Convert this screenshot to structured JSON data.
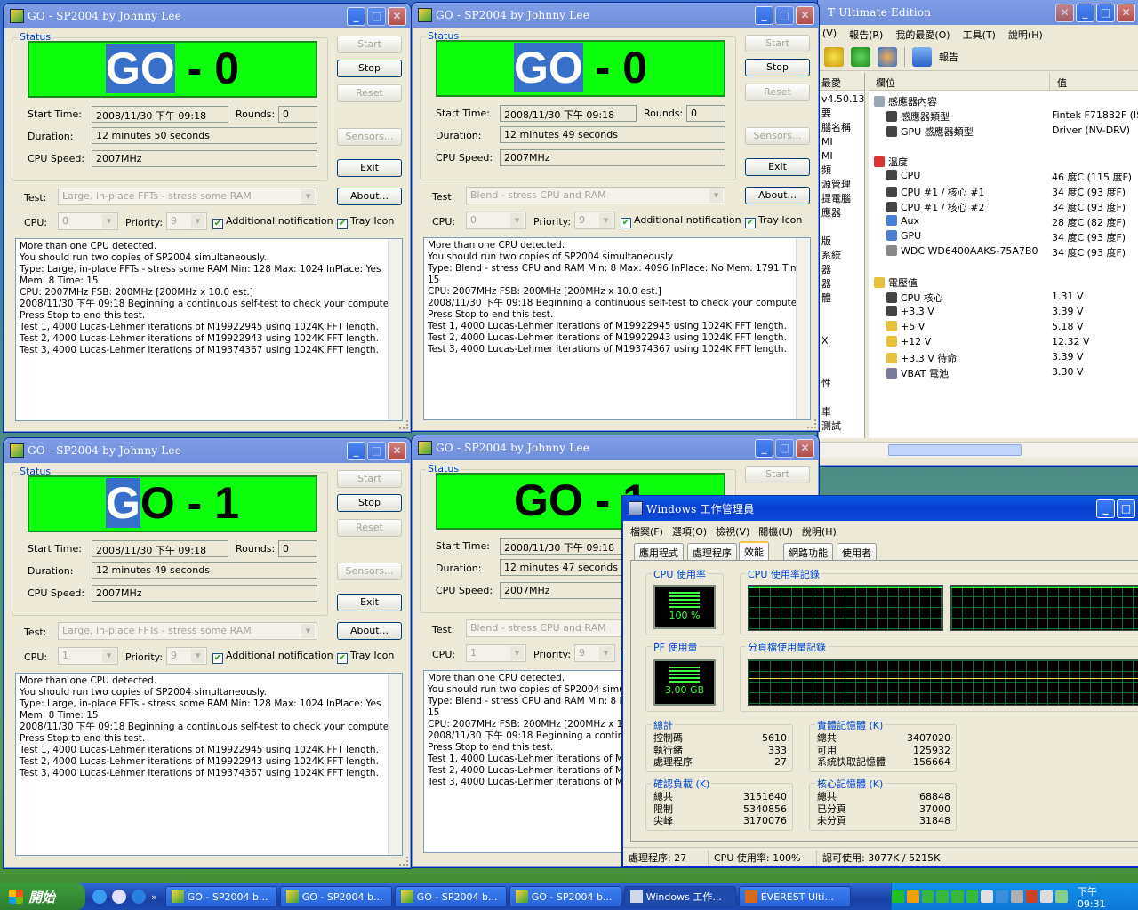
{
  "sp_windows": [
    {
      "title": "GO - SP2004 by Johnny Lee",
      "status_label": "Status",
      "go_pre": "",
      "go_hl": "GO",
      "go_post": " - 0",
      "go_mode": "b",
      "start_time_label": "Start Time:",
      "start_time": "2008/11/30 下午 09:18",
      "rounds_label": "Rounds:",
      "rounds": "0",
      "duration_label": "Duration:",
      "duration": "12 minutes 50 seconds",
      "cpu_speed_label": "CPU Speed:",
      "cpu_speed": "2007MHz",
      "btn_start": "Start",
      "btn_stop": "Stop",
      "btn_reset": "Reset",
      "btn_sensors": "Sensors...",
      "btn_exit": "Exit",
      "btn_about": "About...",
      "test_label": "Test:",
      "test_value": "Large, in-place FFTs - stress some RAM",
      "cpu_label": "CPU:",
      "cpu_value": "0",
      "priority_label": "Priority:",
      "priority_value": "9",
      "notif_label": "Additional notification",
      "tray_label": "Tray Icon",
      "log": "More than one CPU detected.\nYou should run two copies of SP2004 simultaneously.\nType: Large, in-place FFTs - stress some RAM Min: 128 Max: 1024 InPlace: Yes\nMem: 8 Time: 15\nCPU: 2007MHz FSB: 200MHz [200MHz x 10.0 est.]\n2008/11/30 下午 09:18 Beginning a continuous self-test to check your computer.\nPress Stop to end this test.\nTest 1, 4000 Lucas-Lehmer iterations of M19922945 using 1024K FFT length.\nTest 2, 4000 Lucas-Lehmer iterations of M19922943 using 1024K FFT length.\nTest 3, 4000 Lucas-Lehmer iterations of M19374367 using 1024K FFT length."
    },
    {
      "title": "GO - SP2004 by Johnny Lee",
      "status_label": "Status",
      "go_pre": "",
      "go_hl": "GO",
      "go_post": " - 0",
      "go_mode": "all",
      "start_time_label": "Start Time:",
      "start_time": "2008/11/30 下午 09:18",
      "rounds_label": "Rounds:",
      "rounds": "0",
      "duration_label": "Duration:",
      "duration": "12 minutes 49 seconds",
      "cpu_speed_label": "CPU Speed:",
      "cpu_speed": "2007MHz",
      "btn_start": "Start",
      "btn_stop": "Stop",
      "btn_reset": "Reset",
      "btn_sensors": "Sensors...",
      "btn_exit": "Exit",
      "btn_about": "About...",
      "test_label": "Test:",
      "test_value": "Blend - stress CPU and RAM",
      "cpu_label": "CPU:",
      "cpu_value": "0",
      "priority_label": "Priority:",
      "priority_value": "9",
      "notif_label": "Additional notification",
      "tray_label": "Tray Icon",
      "log": "More than one CPU detected.\nYou should run two copies of SP2004 simultaneously.\nType: Blend - stress CPU and RAM Min: 8 Max: 4096 InPlace: No Mem: 1791 Time:\n15\nCPU: 2007MHz FSB: 200MHz [200MHz x 10.0 est.]\n2008/11/30 下午 09:18 Beginning a continuous self-test to check your computer.\nPress Stop to end this test.\nTest 1, 4000 Lucas-Lehmer iterations of M19922945 using 1024K FFT length.\nTest 2, 4000 Lucas-Lehmer iterations of M19922943 using 1024K FFT length.\nTest 3, 4000 Lucas-Lehmer iterations of M19374367 using 1024K FFT length."
    },
    {
      "title": "GO - SP2004 by Johnny Lee",
      "status_label": "Status",
      "go_pre": "",
      "go_hl": "G",
      "go_post": "O - 1",
      "go_mode": "g",
      "start_time_label": "Start Time:",
      "start_time": "2008/11/30 下午 09:18",
      "rounds_label": "Rounds:",
      "rounds": "0",
      "duration_label": "Duration:",
      "duration": "12 minutes 49 seconds",
      "cpu_speed_label": "CPU Speed:",
      "cpu_speed": "2007MHz",
      "btn_start": "Start",
      "btn_stop": "Stop",
      "btn_reset": "Reset",
      "btn_sensors": "Sensors...",
      "btn_exit": "Exit",
      "btn_about": "About...",
      "test_label": "Test:",
      "test_value": "Large, in-place FFTs - stress some RAM",
      "cpu_label": "CPU:",
      "cpu_value": "1",
      "priority_label": "Priority:",
      "priority_value": "9",
      "notif_label": "Additional notification",
      "tray_label": "Tray Icon",
      "log": "More than one CPU detected.\nYou should run two copies of SP2004 simultaneously.\nType: Large, in-place FFTs - stress some RAM Min: 128 Max: 1024 InPlace: Yes\nMem: 8 Time: 15\n2008/11/30 下午 09:18 Beginning a continuous self-test to check your computer.\nPress Stop to end this test.\nTest 1, 4000 Lucas-Lehmer iterations of M19922945 using 1024K FFT length.\nTest 2, 4000 Lucas-Lehmer iterations of M19922943 using 1024K FFT length.\nTest 3, 4000 Lucas-Lehmer iterations of M19374367 using 1024K FFT length."
    },
    {
      "title": "GO - SP2004 by Johnny Lee",
      "status_label": "Status",
      "go_pre": "GO - 1",
      "go_hl": "",
      "go_post": "",
      "go_mode": "none",
      "start_time_label": "Start Time:",
      "start_time": "2008/11/30 下午 09:18",
      "rounds_label": "",
      "rounds": "",
      "duration_label": "Duration:",
      "duration": "12 minutes 47 seconds",
      "cpu_speed_label": "CPU Speed:",
      "cpu_speed": "2007MHz",
      "btn_start": "Start",
      "btn_stop": "",
      "btn_reset": "",
      "btn_sensors": "",
      "btn_exit": "",
      "btn_about": "",
      "test_label": "Test:",
      "test_value": "Blend - stress CPU and RAM",
      "cpu_label": "CPU:",
      "cpu_value": "1",
      "priority_label": "Priority:",
      "priority_value": "9",
      "notif_label": "",
      "tray_label": "",
      "log": "More than one CPU detected.\nYou should run two copies of SP2004 simultan\nType: Blend - stress CPU and RAM Min: 8 Max\n15\nCPU: 2007MHz FSB: 200MHz [200MHz x 10.0 es\n2008/11/30 下午 09:18 Beginning a continuou\nPress Stop to end this test.\nTest 1, 4000 Lucas-Lehmer iterations of M199\nTest 2, 4000 Lucas-Lehmer iterations of M199\nTest 3, 4000 Lucas-Lehmer iterations of M193"
    }
  ],
  "everest": {
    "title": "T Ultimate Edition",
    "menu": [
      "報告(R)",
      "我的最愛(O)",
      "工具(T)",
      "說明(H)"
    ],
    "menu_partial": "(V)",
    "report_btn": "報告",
    "left_header": "最愛",
    "left_items": [
      "v4.50.13",
      "要",
      "腦名稱",
      "MI",
      "MI",
      "頻",
      "源管理",
      "提電腦",
      "應器",
      "",
      "版",
      "系統",
      "器",
      "器",
      "體",
      "",
      "",
      "X",
      "",
      "",
      "性",
      "",
      "車",
      "測試"
    ],
    "col_field": "欄位",
    "col_value": "值",
    "rows": [
      {
        "f": "感應器內容",
        "v": "",
        "indent": 0,
        "kind": "group"
      },
      {
        "f": "感應器類型",
        "v": "Fintek F71882F (IS",
        "indent": 1,
        "kind": "chip"
      },
      {
        "f": "GPU 感應器類型",
        "v": "Driver (NV-DRV)",
        "indent": 1,
        "kind": "chip"
      },
      {
        "f": "",
        "v": "",
        "indent": 0,
        "kind": "gap"
      },
      {
        "f": "溫度",
        "v": "",
        "indent": 0,
        "kind": "therm"
      },
      {
        "f": "CPU",
        "v": "46 度C (115 度F)",
        "indent": 1,
        "kind": "chip"
      },
      {
        "f": "CPU #1 / 核心 #1",
        "v": "34 度C (93 度F)",
        "indent": 1,
        "kind": "chip"
      },
      {
        "f": "CPU #1 / 核心 #2",
        "v": "34 度C (93 度F)",
        "indent": 1,
        "kind": "chip"
      },
      {
        "f": "Aux",
        "v": "28 度C (82 度F)",
        "indent": 1,
        "kind": "pc"
      },
      {
        "f": "GPU",
        "v": "34 度C (93 度F)",
        "indent": 1,
        "kind": "pc"
      },
      {
        "f": "WDC WD6400AAKS-75A7B0",
        "v": "34 度C (93 度F)",
        "indent": 1,
        "kind": "disk"
      },
      {
        "f": "",
        "v": "",
        "indent": 0,
        "kind": "gap"
      },
      {
        "f": "電壓值",
        "v": "",
        "indent": 0,
        "kind": "warn"
      },
      {
        "f": "CPU 核心",
        "v": "1.31 V",
        "indent": 1,
        "kind": "chip"
      },
      {
        "f": "+3.3 V",
        "v": "3.39 V",
        "indent": 1,
        "kind": "chip"
      },
      {
        "f": "+5 V",
        "v": "5.18 V",
        "indent": 1,
        "kind": "warn"
      },
      {
        "f": "+12 V",
        "v": "12.32 V",
        "indent": 1,
        "kind": "warn"
      },
      {
        "f": "+3.3 V 待命",
        "v": "3.39 V",
        "indent": 1,
        "kind": "warn"
      },
      {
        "f": "VBAT 電池",
        "v": "3.30 V",
        "indent": 1,
        "kind": "bat"
      }
    ]
  },
  "taskmgr": {
    "title": "Windows 工作管理員",
    "menu": [
      "檔案(F)",
      "選項(O)",
      "檢視(V)",
      "關機(U)",
      "說明(H)"
    ],
    "tabs": [
      "應用程式",
      "處理程序",
      "效能",
      "網路功能",
      "使用者"
    ],
    "active_tab": 2,
    "cpu_usage_label": "CPU 使用率",
    "cpu_usage_value": "100 %",
    "cpu_history_label": "CPU 使用率記錄",
    "pf_label": "PF 使用量",
    "pf_value": "3.00 GB",
    "pf_history_label": "分頁檔使用量記錄",
    "totals": {
      "label": "總計",
      "rows": [
        [
          "控制碼",
          "5610"
        ],
        [
          "執行緒",
          "333"
        ],
        [
          "處理程序",
          "27"
        ]
      ]
    },
    "physical": {
      "label": "實體記憶體 (K)",
      "rows": [
        [
          "總共",
          "3407020"
        ],
        [
          "可用",
          "125932"
        ],
        [
          "系統快取記憶體",
          "156664"
        ]
      ]
    },
    "commit": {
      "label": "確認負載 (K)",
      "rows": [
        [
          "總共",
          "3151640"
        ],
        [
          "限制",
          "5340856"
        ],
        [
          "尖峰",
          "3170076"
        ]
      ]
    },
    "kernel": {
      "label": "核心記憶體 (K)",
      "rows": [
        [
          "總共",
          "68848"
        ],
        [
          "已分頁",
          "37000"
        ],
        [
          "未分頁",
          "31848"
        ]
      ]
    },
    "status_procs": "處理程序: 27",
    "status_cpu": "CPU 使用率: 100%",
    "status_commit": "認可使用: 3077K / 5215K"
  },
  "taskbar": {
    "start": "開始",
    "items": [
      "GO - SP2004 b...",
      "GO - SP2004 b...",
      "GO - SP2004 b...",
      "GO - SP2004 b...",
      "Windows 工作...",
      "EVEREST Ulti..."
    ],
    "clock": "下午 09:31"
  },
  "colors": {
    "go_green": "#0dff0d",
    "go_highlight": "#3870c9",
    "xp_blue": "#0a3fd0",
    "graph_green": "#3eff3e"
  }
}
